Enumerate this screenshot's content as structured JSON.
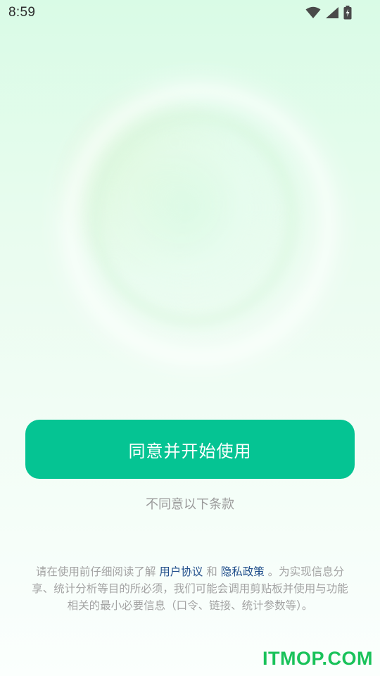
{
  "status_bar": {
    "time": "8:59",
    "icons": [
      "wifi-icon",
      "cellular-signal-icon",
      "battery-charging-icon"
    ]
  },
  "actions": {
    "agree_label": "同意并开始使用",
    "disagree_label": "不同意以下条款"
  },
  "notice": {
    "prefix": "请在使用前仔细阅读了解",
    "user_agreement": "用户协议",
    "and": "和",
    "privacy_policy": "隐私政策",
    "suffix": "。为实现信息分享、统计分析等目的所必须，我们可能会调用剪贴板并使用与功能相关的最小必要信息（口令、链接、统计参数等）。"
  },
  "watermark": "ITMOP.COM",
  "colors": {
    "accent": "#05c493",
    "link": "#1f4d8a",
    "watermark": "#19c25a"
  }
}
